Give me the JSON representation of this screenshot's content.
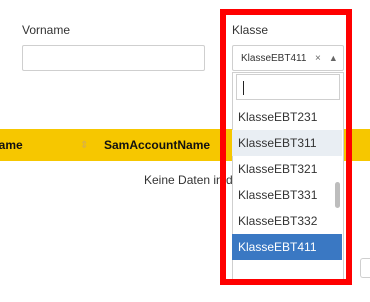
{
  "form": {
    "vorname_label": "Vorname",
    "vorname_value": "",
    "klasse_label": "Klasse",
    "klasse_selected": "KlasseEBT411",
    "clear_glyph": "×",
    "caret_glyph": "▲"
  },
  "table": {
    "col_name": "Name",
    "col_sam": "SamAccountName",
    "empty": "Keine Daten in der Tabelle"
  },
  "dropdown": {
    "search_value": "",
    "options": [
      {
        "label": "KlasseEBT231",
        "state": "normal"
      },
      {
        "label": "KlasseEBT311",
        "state": "hover"
      },
      {
        "label": "KlasseEBT321",
        "state": "normal"
      },
      {
        "label": "KlasseEBT331",
        "state": "normal"
      },
      {
        "label": "KlasseEBT332",
        "state": "normal"
      },
      {
        "label": "KlasseEBT411",
        "state": "selected"
      }
    ]
  },
  "colors": {
    "header_bg": "#f6c700",
    "highlight_border": "#ff0000",
    "selected_bg": "#3a78c3",
    "hover_bg": "#e9eef3"
  }
}
